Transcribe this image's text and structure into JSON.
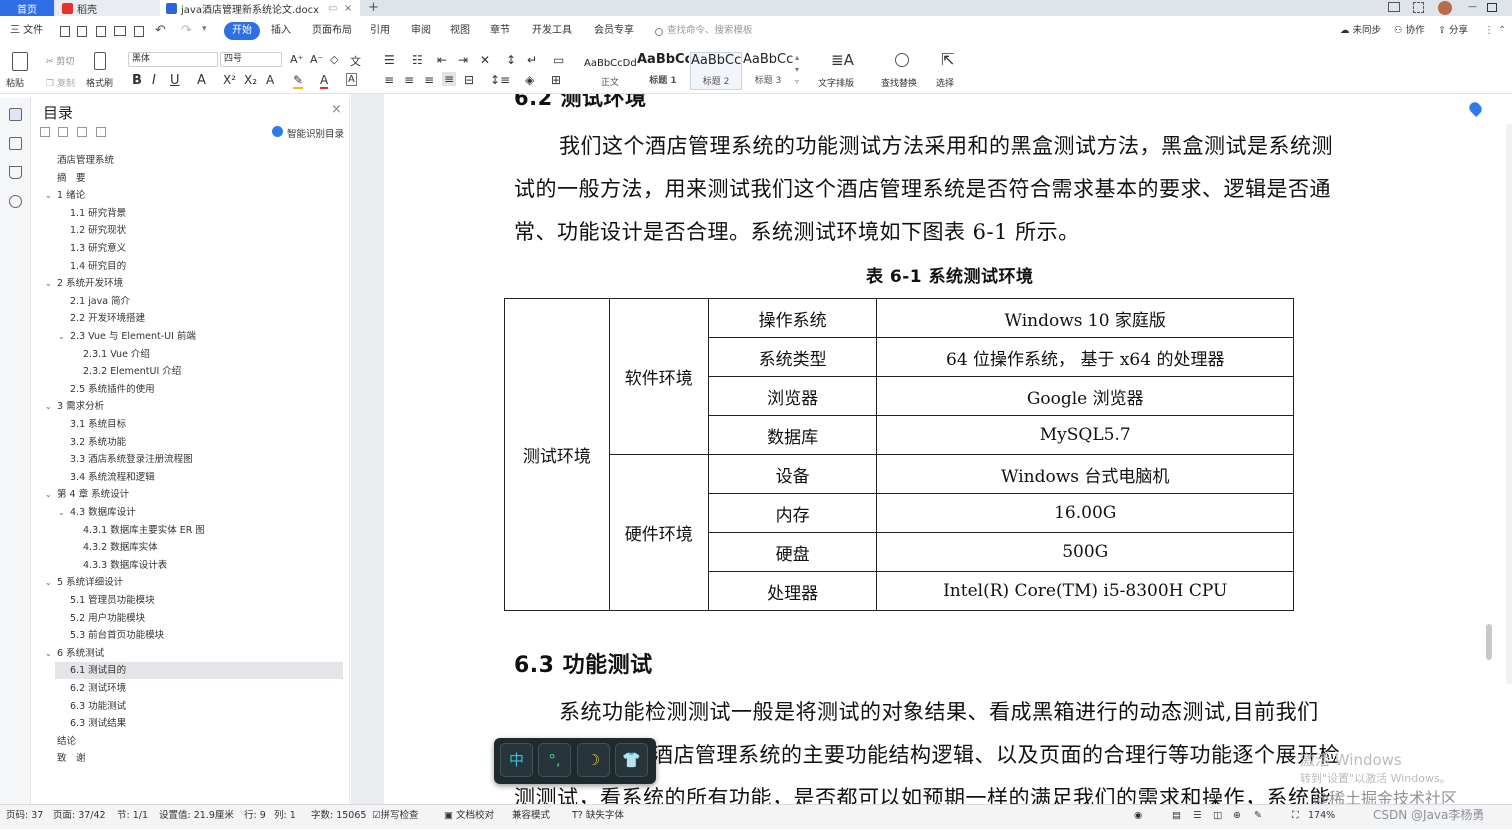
{
  "tabs": {
    "home": "首页",
    "daoke": "稻壳",
    "doc_title": "java酒店管理新系统论文.docx"
  },
  "menu": {
    "file": "三 文件",
    "start": "开始",
    "insert": "插入",
    "layout": "页面布局",
    "reference": "引用",
    "review": "审阅",
    "view": "视图",
    "chapter": "章节",
    "devtools": "开发工具",
    "member": "会员专享",
    "search_placeholder": "查找命令、搜索模板",
    "unsynced": "未同步",
    "collab": "协作",
    "share": "分享"
  },
  "ribbon": {
    "paste": "粘贴",
    "cut": "剪切",
    "copy": "复制",
    "format_painter": "格式刷",
    "font_name": "黑体",
    "font_size": "四号",
    "styles": [
      {
        "preview": "AaBbCcDd",
        "label": "正文"
      },
      {
        "preview": "AaBbCc",
        "label": "标题 1"
      },
      {
        "preview": "AaBbCcI",
        "label": "标题 2"
      },
      {
        "preview": "AaBbCc",
        "label": "标题 3"
      }
    ],
    "text_layout": "文字排版",
    "find_replace": "查找替换",
    "select": "选择"
  },
  "toc": {
    "title": "目录",
    "smart": "智能识别目录",
    "items": [
      {
        "text": "酒店管理系统",
        "level": 0,
        "arrow": ""
      },
      {
        "text": "摘　要",
        "level": 0,
        "arrow": ""
      },
      {
        "text": "1  绪论",
        "level": 0,
        "arrow": "⌄"
      },
      {
        "text": "1.1 研究背景",
        "level": 1,
        "arrow": ""
      },
      {
        "text": "1.2 研究现状",
        "level": 1,
        "arrow": ""
      },
      {
        "text": "1.3  研究意义",
        "level": 1,
        "arrow": ""
      },
      {
        "text": "1.4 研究目的",
        "level": 1,
        "arrow": ""
      },
      {
        "text": "2  系统开发环境",
        "level": 0,
        "arrow": "⌄"
      },
      {
        "text": "2.1 java 简介",
        "level": 1,
        "arrow": ""
      },
      {
        "text": "2.2  开发环境搭建",
        "level": 1,
        "arrow": ""
      },
      {
        "text": "2.3 Vue 与 Element-UI 前端",
        "level": 1,
        "arrow": "⌄"
      },
      {
        "text": "2.3.1 Vue 介绍",
        "level": 2,
        "arrow": ""
      },
      {
        "text": "2.3.2 ElementUI 介绍",
        "level": 2,
        "arrow": ""
      },
      {
        "text": "2.5 系统插件的使用",
        "level": 1,
        "arrow": ""
      },
      {
        "text": "3  需求分析",
        "level": 0,
        "arrow": "⌄"
      },
      {
        "text": "3.1 系统目标",
        "level": 1,
        "arrow": ""
      },
      {
        "text": "3.2 系统功能",
        "level": 1,
        "arrow": ""
      },
      {
        "text": "3.3 酒店系统登录注册流程图",
        "level": 1,
        "arrow": ""
      },
      {
        "text": "3.4 系统流程和逻辑",
        "level": 1,
        "arrow": ""
      },
      {
        "text": "第 4 章  系统设计",
        "level": 0,
        "arrow": "⌄"
      },
      {
        "text": "4.3 数据库设计",
        "level": 1,
        "arrow": "⌄"
      },
      {
        "text": "4.3.1  数据库主要实体 ER 图",
        "level": 2,
        "arrow": ""
      },
      {
        "text": "4.3.2  数据库实体",
        "level": 2,
        "arrow": ""
      },
      {
        "text": "4.3.3  数据库设计表",
        "level": 2,
        "arrow": ""
      },
      {
        "text": "5  系统详细设计",
        "level": 0,
        "arrow": "⌄"
      },
      {
        "text": "5.1 管理员功能模块",
        "level": 1,
        "arrow": ""
      },
      {
        "text": "5.2 用户功能模块",
        "level": 1,
        "arrow": ""
      },
      {
        "text": "5.3 前台首页功能模块",
        "level": 1,
        "arrow": ""
      },
      {
        "text": "6  系统测试",
        "level": 0,
        "arrow": "⌄"
      },
      {
        "text": "6.1  测试目的",
        "level": 1,
        "arrow": ""
      },
      {
        "text": "6.2  测试环境",
        "level": 1,
        "arrow": ""
      },
      {
        "text": "6.3  功能测试",
        "level": 1,
        "arrow": ""
      },
      {
        "text": "6.3  测试结果",
        "level": 1,
        "arrow": ""
      },
      {
        "text": "结论",
        "level": 0,
        "arrow": ""
      },
      {
        "text": "致　谢",
        "level": 0,
        "arrow": ""
      }
    ]
  },
  "doc": {
    "partial_heading": "6.2  测试环境",
    "para1_line1": "我们这个酒店管理系统的功能测试方法采用和的黑盒测试方法，黑盒测试是系统测",
    "para1_line2": "试的一般方法，用来测试我们这个酒店管理系统是否符合需求基本的要求、逻辑是否通",
    "para1_line3": "常、功能设计是否合理。系统测试环境如下图表 6-1 所示。",
    "table_caption": "表 6-1 系统测试环境",
    "table": {
      "group": "测试环境",
      "software": "软件环境",
      "hardware": "硬件环境",
      "rows": [
        {
          "k": "操作系统",
          "v": "Windows  10 家庭版"
        },
        {
          "k": "系统类型",
          "v": "64  位操作系统， 基于  x64  的处理器"
        },
        {
          "k": "浏览器",
          "v": "Google 浏览器"
        },
        {
          "k": "数据库",
          "v": "MySQL5.7"
        },
        {
          "k": "设备",
          "v": "Windows 台式电脑机"
        },
        {
          "k": "内存",
          "v": "16.00G"
        },
        {
          "k": "硬盘",
          "v": "500G"
        },
        {
          "k": "处理器",
          "v": "Intel(R)  Core(TM)  i5-8300H  CPU"
        }
      ]
    },
    "heading_63": "6.3  功能测试",
    "para2_line1": "系统功能检测测试一般是将测试的对象结果、看成黑箱进行的动态测试,目前我们",
    "para2_line2": "酒店管理系统的主要功能结构逻辑、以及页面的合理行等功能逐个展开检",
    "para2_line3": "测测试，看系统的所有功能，是否都可以如预期一样的满足我们的需求和操作，系统能"
  },
  "floatbar": {
    "b1": "中",
    "b2": "°,",
    "b3": "☽",
    "b4": "👕"
  },
  "watermark": {
    "line1": "激活 Windows",
    "line2": "转到\"设置\"以激活 Windows。",
    "csdn": "@稀土掘金技术社区",
    "csdn2": "CSDN @Java李杨勇"
  },
  "status": {
    "page_code": "页码: 37",
    "page": "页面: 37/42",
    "section": "节: 1/1",
    "setting": "设置值: 21.9厘米",
    "row": "行: 9",
    "col": "列: 1",
    "words": "字数: 15065",
    "spellcheck": "拼写检查",
    "proofread": "文档校对",
    "compat": "兼容模式",
    "missing_font": "缺失字体",
    "zoom": "174%"
  }
}
